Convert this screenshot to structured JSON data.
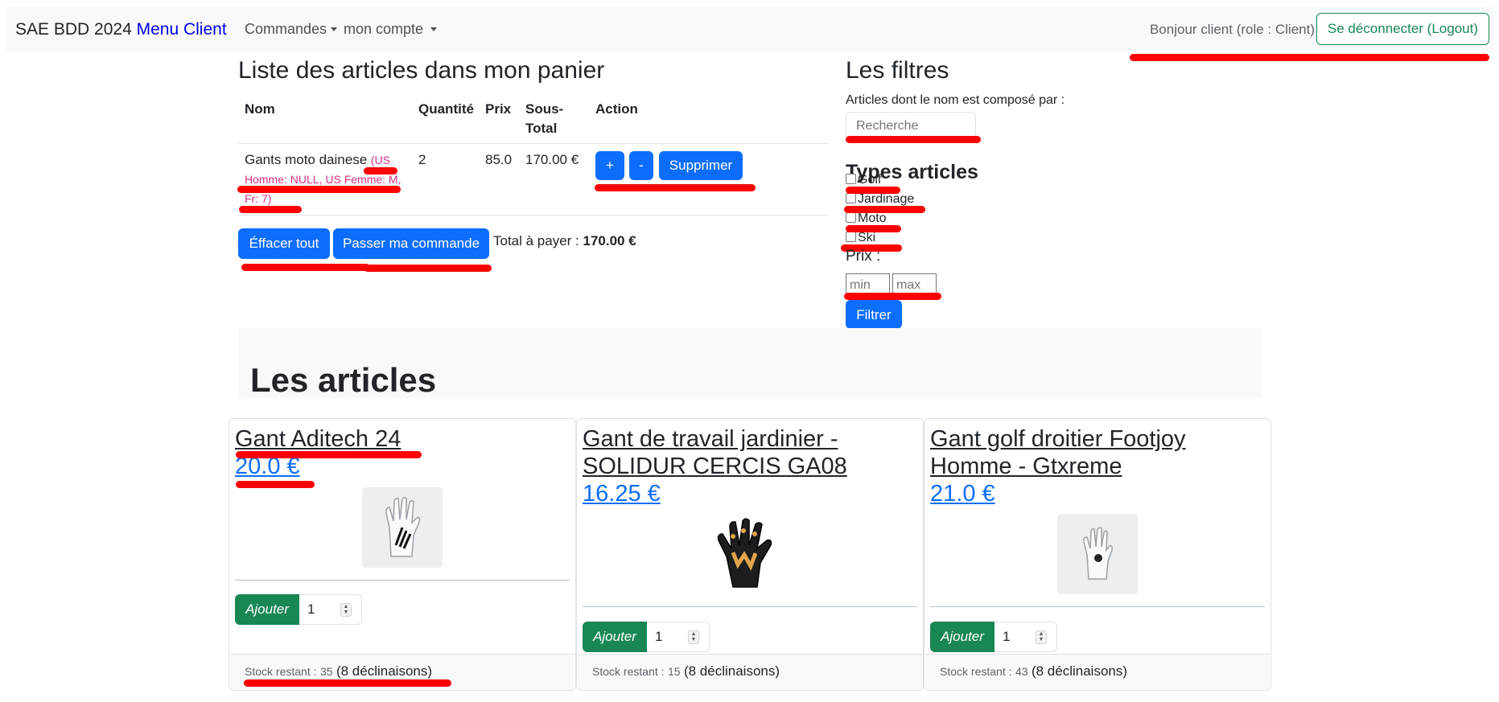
{
  "navbar": {
    "brand": "SAE BDD 2024",
    "brand_menu": "Menu Client",
    "commandes": "Commandes",
    "mon_compte": "mon compte",
    "greeting": "Bonjour client (role : Client)",
    "logout": "Se déconnecter (Logout)"
  },
  "cart": {
    "title": "Liste des articles dans mon panier",
    "headers": {
      "nom": "Nom",
      "quantite": "Quantité",
      "prix": "Prix",
      "sous_total_1": "Sous-",
      "sous_total_2": "Total",
      "action": "Action"
    },
    "items": [
      {
        "nom": "Gants moto dainese",
        "variant": "(US Homme: NULL, US Femme: M, Fr: 7)",
        "quantite": "2",
        "prix": "85.0",
        "sous_total": "170.00 €",
        "plus": "+",
        "minus": "-",
        "delete": "Supprimer"
      }
    ],
    "clear_all": "Éffacer tout",
    "checkout": "Passer ma commande",
    "total_label": "Total à payer :",
    "total_value": "170.00 €"
  },
  "filters": {
    "title": "Les filtres",
    "name_label": "Articles dont le nom est composé par :",
    "search_placeholder": "Recherche",
    "types_title": "Types articles",
    "types": [
      "Golf",
      "Jardinage",
      "Moto",
      "Ski"
    ],
    "prix_label": "Prix :",
    "min_placeholder": "min",
    "max_placeholder": "max",
    "filter_button": "Filtrer"
  },
  "articles": {
    "title": "Les articles",
    "cards": [
      {
        "name": "Gant Aditech 24",
        "price": "20.0 €",
        "add": "Ajouter",
        "qty": "1",
        "stock_label": "Stock restant :",
        "stock_value": "35",
        "declinaisons": "(8 déclinaisons)",
        "image_icon": "golf-glove-white-image"
      },
      {
        "name": "Gant de travail jardinier - SOLIDUR CERCIS GA08",
        "price": "16.25 €",
        "add": "Ajouter",
        "qty": "1",
        "stock_label": "Stock restant :",
        "stock_value": "15",
        "declinaisons": "(8 déclinaisons)",
        "image_icon": "work-glove-black-orange-image"
      },
      {
        "name": "Gant golf droitier Footjoy Homme - Gtxreme",
        "price": "21.0 €",
        "add": "Ajouter",
        "qty": "1",
        "stock_label": "Stock restant :",
        "stock_value": "43",
        "declinaisons": "(8 déclinaisons)",
        "image_icon": "golf-glove-footjoy-image"
      }
    ]
  },
  "colors": {
    "primary": "#0d6efd",
    "success": "#198754",
    "annotation_red": "#ff0000",
    "variant_pink": "#d63384"
  }
}
